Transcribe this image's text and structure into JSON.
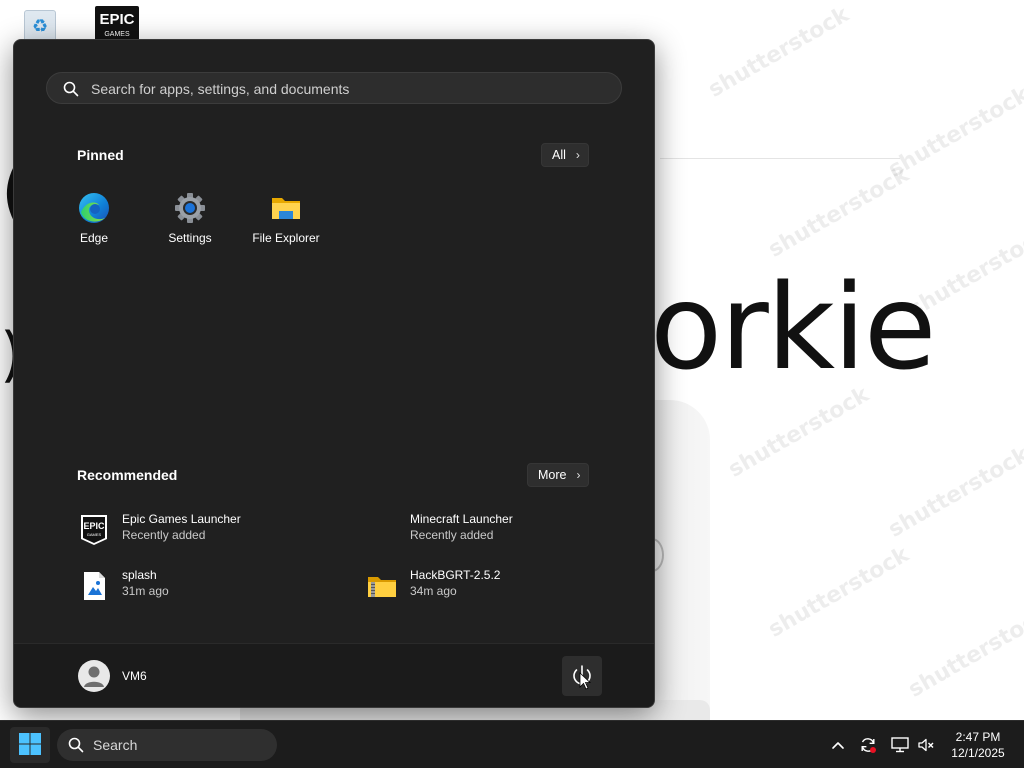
{
  "desktop": {
    "wallpaper_text": "orkie",
    "icons": [
      {
        "name": "recycle-bin",
        "label": ""
      },
      {
        "name": "epic-games",
        "line1": "EPIC",
        "line2": "GAMES"
      }
    ]
  },
  "start_menu": {
    "search": {
      "placeholder": "Search for apps, settings, and documents"
    },
    "pinned": {
      "title": "Pinned",
      "all_button": "All",
      "apps": [
        {
          "label": "Edge",
          "icon": "edge-icon"
        },
        {
          "label": "Settings",
          "icon": "settings-gear-icon"
        },
        {
          "label": "File Explorer",
          "icon": "folder-icon"
        }
      ]
    },
    "recommended": {
      "title": "Recommended",
      "more_button": "More",
      "items": [
        {
          "name": "Epic Games Launcher",
          "sub": "Recently added",
          "icon": "epic-games-icon"
        },
        {
          "name": "Minecraft Launcher",
          "sub": "Recently added",
          "icon": ""
        },
        {
          "name": "splash",
          "sub": "31m ago",
          "icon": "image-file-icon"
        },
        {
          "name": "HackBGRT-2.5.2",
          "sub": "34m ago",
          "icon": "zip-folder-icon"
        }
      ]
    },
    "user": {
      "name": "VM6"
    },
    "power_icon": "power-icon"
  },
  "taskbar": {
    "search_label": "Search",
    "clock": {
      "time": "2:47 PM",
      "date": "12/1/2025"
    },
    "tray_icons": [
      "chevron-up-icon",
      "sync-icon",
      "network-icon",
      "speaker-muted-icon"
    ]
  },
  "colors": {
    "menu_bg": "#202020",
    "footer_bg": "#1b1b1b",
    "taskbar_bg": "#1c1c1c",
    "accent": "#0078d4"
  }
}
